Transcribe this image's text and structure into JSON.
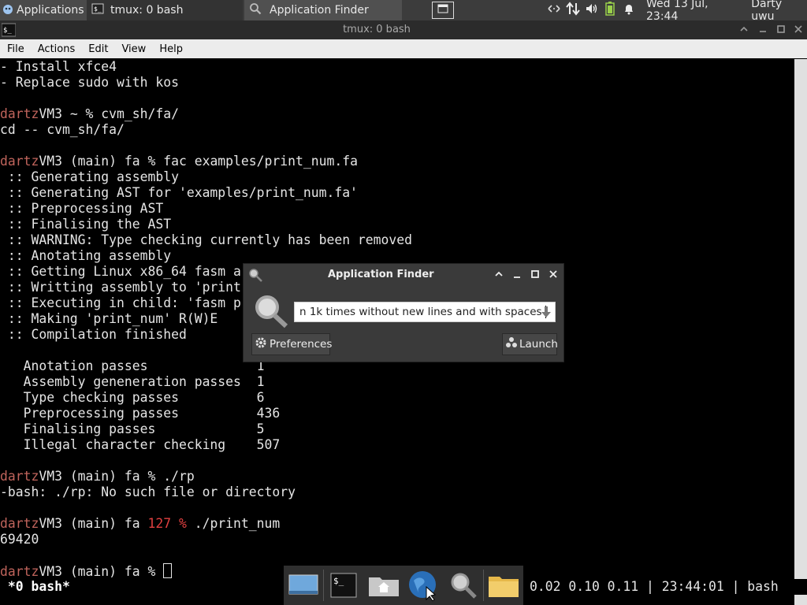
{
  "panel": {
    "apps_label": "Applications",
    "task_tmux": "tmux: 0 bash",
    "task_finder": "Application Finder",
    "clock": "Wed 13 Jul, 23:44",
    "user": "Darty uwu"
  },
  "window": {
    "title": "tmux: 0 bash",
    "menu": [
      "File",
      "Actions",
      "Edit",
      "View",
      "Help"
    ]
  },
  "terminal": {
    "lines": [
      "- Install xfce4",
      "- Replace sudo with kos",
      "",
      "@@VM3 ~ % cvm_sh/fa/",
      "cd -- cvm_sh/fa/",
      "",
      "@@VM3 (main) fa % fac examples/print_num.fa",
      " :: Generating assembly",
      " :: Generating AST for 'examples/print_num.fa'",
      " :: Preprocessing AST",
      " :: Finalising the AST",
      " :: WARNING: Type checking currently has been removed",
      " :: Anotating assembly",
      " :: Getting Linux x86_64 fasm a",
      " :: Writting assembly to 'print",
      " :: Executing in child: 'fasm p",
      " :: Making 'print_num' R(W)E",
      " :: Compilation finished",
      "",
      "   Anotation passes              1",
      "   Assembly geneneration passes  1",
      "   Type checking passes          6",
      "   Preprocessing passes          436",
      "   Finalising passes             5",
      "   Illegal character checking    507",
      "",
      "@@VM3 (main) fa % ./rp",
      "-bash: ./rp: No such file or directory",
      "",
      "@@VM3 (main) fa ##127 %## ./print_num",
      "69420",
      "",
      "@@VM3 (main) fa % "
    ],
    "prompt_user": "dartz",
    "status_left": " *0 bash*",
    "status_right": "0.02 0.10 0.11 | 23:44:01 | bash"
  },
  "finder": {
    "title": "Application Finder",
    "query": "n 1k times without new lines and with spaces",
    "preferences_label": "Preferences",
    "launch_label": "Launch"
  },
  "dock": {
    "items": [
      "show-desktop-icon",
      "terminal-icon",
      "home-folder-icon",
      "web-browser-icon",
      "app-finder-icon",
      "folder-icon"
    ]
  }
}
